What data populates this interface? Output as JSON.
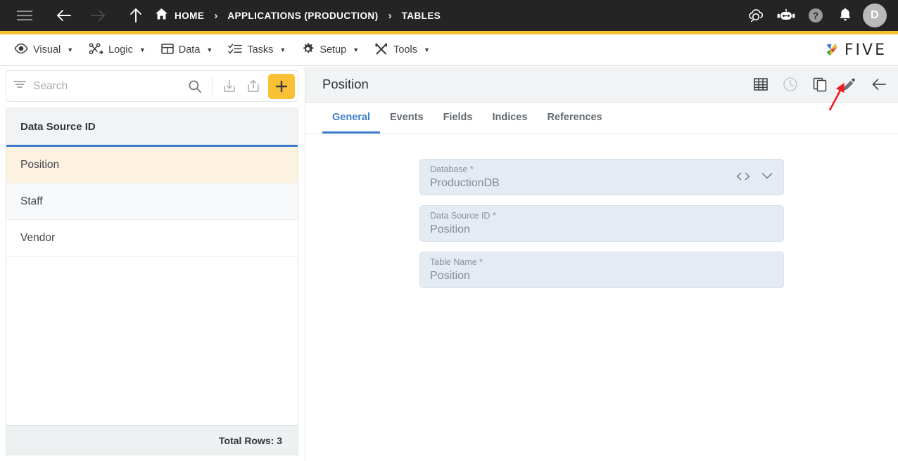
{
  "topbar": {
    "menu_icon": "hamburger-icon",
    "back_icon": "arrow-left-icon",
    "forward_icon": "arrow-right-icon",
    "up_icon": "arrow-up-icon",
    "home_icon": "home-icon",
    "breadcrumb": [
      {
        "label": "HOME"
      },
      {
        "label": "APPLICATIONS (PRODUCTION)"
      },
      {
        "label": "TABLES"
      }
    ],
    "separator": "›",
    "right_icons": [
      {
        "name": "cloud-search-icon"
      },
      {
        "name": "chat-bot-icon"
      },
      {
        "name": "help-icon"
      },
      {
        "name": "notifications-bell-icon"
      }
    ],
    "avatar_initial": "D",
    "accent_color": "#f7c02f"
  },
  "menubar": {
    "items": [
      {
        "label": "Visual",
        "icon": "eye-icon"
      },
      {
        "label": "Logic",
        "icon": "logic-nodes-icon"
      },
      {
        "label": "Data",
        "icon": "table-icon"
      },
      {
        "label": "Tasks",
        "icon": "checklist-icon"
      },
      {
        "label": "Setup",
        "icon": "gear-icon"
      },
      {
        "label": "Tools",
        "icon": "tools-icon"
      }
    ],
    "caret": "▼",
    "brand": "FIVE"
  },
  "left_panel": {
    "filter_icon": "filter-icon",
    "search_placeholder": "Search",
    "search_value": "",
    "search_icon": "search-icon",
    "import_icon": "import-icon",
    "export_icon": "export-icon",
    "add_icon": "plus-icon",
    "grid": {
      "column_header": "Data Source ID",
      "rows": [
        {
          "label": "Position",
          "selected": true
        },
        {
          "label": "Staff",
          "selected": false
        },
        {
          "label": "Vendor",
          "selected": false
        }
      ],
      "footer": "Total Rows: 3"
    },
    "selected_row_color": "#fdf2e0",
    "header_underline_color": "#3d7fce"
  },
  "right_panel": {
    "title": "Position",
    "actions": [
      {
        "name": "table-view-icon",
        "enabled": true
      },
      {
        "name": "history-clock-icon",
        "enabled": false
      },
      {
        "name": "duplicate-icon",
        "enabled": true
      },
      {
        "name": "edit-pencil-icon",
        "enabled": true
      },
      {
        "name": "back-arrow-icon",
        "enabled": true
      }
    ],
    "tabs": [
      {
        "label": "General",
        "active": true
      },
      {
        "label": "Events",
        "active": false
      },
      {
        "label": "Fields",
        "active": false
      },
      {
        "label": "Indices",
        "active": false
      },
      {
        "label": "References",
        "active": false
      }
    ],
    "active_tab_color": "#3d7fce",
    "fields": [
      {
        "label": "Database *",
        "value": "ProductionDB",
        "code_icon": "code-brackets-icon",
        "dropdown_icon": "chevron-down-icon",
        "has_icons": true
      },
      {
        "label": "Data Source ID *",
        "value": "Position",
        "has_icons": false
      },
      {
        "label": "Table Name *",
        "value": "Position",
        "has_icons": false
      }
    ]
  },
  "annotation": {
    "type": "arrow",
    "color": "#ee1c25",
    "points_to": "edit-pencil-icon"
  }
}
